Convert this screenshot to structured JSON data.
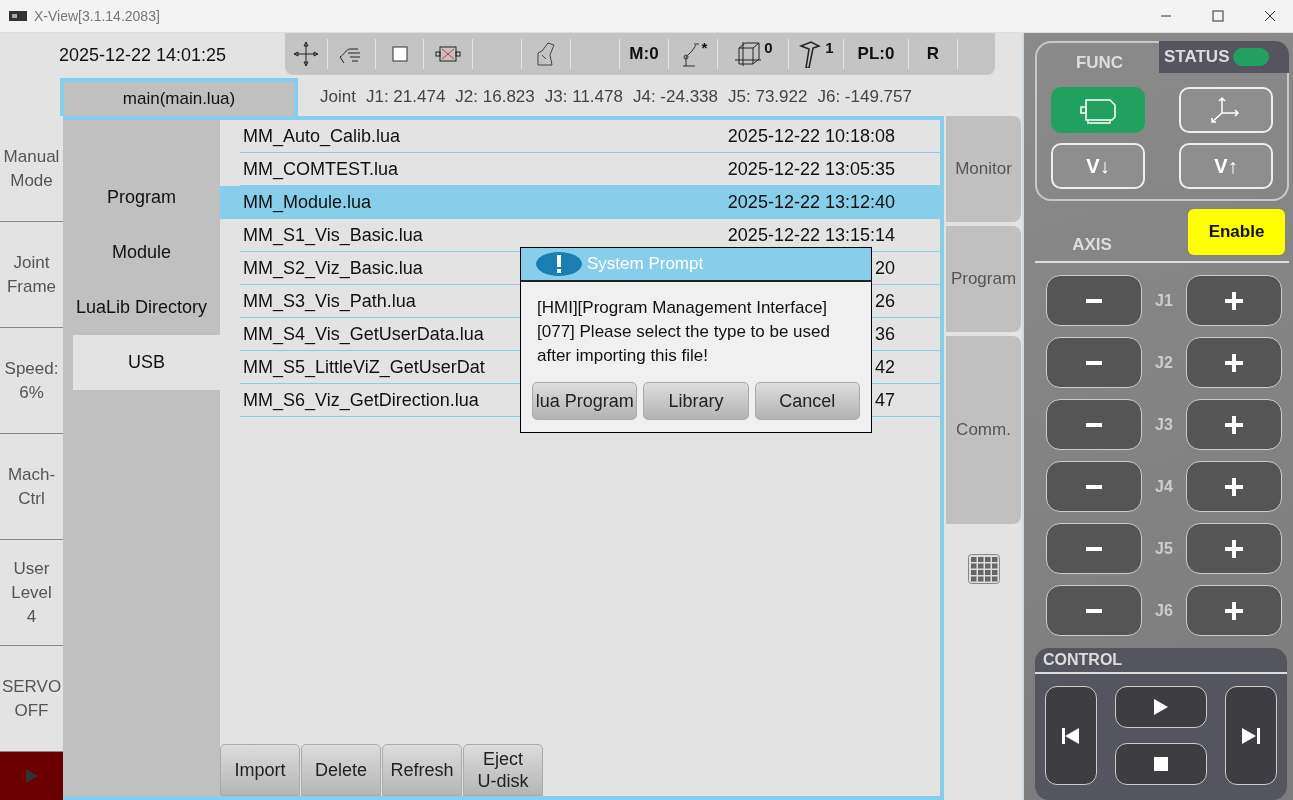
{
  "window": {
    "title": "X-View[3.1.14.2083]"
  },
  "header": {
    "datetime": "2025-12-22 14:01:25",
    "mode_counter": "M:0",
    "robot_mark": "*",
    "frame_count": "0",
    "tool_count": "1",
    "payload": "PL:0",
    "run_mode": "R"
  },
  "tabs": [
    {
      "label": "main(main.lua)",
      "selected": true
    }
  ],
  "coordinates": {
    "frame": "Joint",
    "axes": [
      {
        "label": "J1:",
        "value": "21.474"
      },
      {
        "label": "J2:",
        "value": "16.823"
      },
      {
        "label": "J3:",
        "value": "11.478"
      },
      {
        "label": "J4:",
        "value": "-24.338"
      },
      {
        "label": "J5:",
        "value": "73.922"
      },
      {
        "label": "J6:",
        "value": "-149.757"
      }
    ]
  },
  "mode_nav": [
    {
      "label": "Manual\nMode"
    },
    {
      "label": "Joint\nFrame"
    },
    {
      "label": "Speed:\n6%"
    },
    {
      "label": "Mach-\nCtrl"
    },
    {
      "label": "User\nLevel\n4"
    },
    {
      "label": "SERVO\nOFF"
    }
  ],
  "categories": [
    {
      "label": "Program",
      "selected": false
    },
    {
      "label": "Module",
      "selected": false
    },
    {
      "label": "LuaLib Directory",
      "selected": false
    },
    {
      "label": "USB",
      "selected": true
    }
  ],
  "files": [
    {
      "name": "MM_Auto_Calib.lua",
      "modified": "2025-12-22 10:18:08",
      "selected": false
    },
    {
      "name": "MM_COMTEST.lua",
      "modified": "2025-12-22 13:05:35",
      "selected": false
    },
    {
      "name": "MM_Module.lua",
      "modified": "2025-12-22 13:12:40",
      "selected": true
    },
    {
      "name": "MM_S1_Vis_Basic.lua",
      "modified": "2025-12-22 13:15:14",
      "selected": false
    },
    {
      "name": "MM_S2_Viz_Basic.lua",
      "modified": "20",
      "selected": false
    },
    {
      "name": "MM_S3_Vis_Path.lua",
      "modified": "26",
      "selected": false
    },
    {
      "name": "MM_S4_Vis_GetUserData.lua",
      "modified": "36",
      "selected": false
    },
    {
      "name": "MM_S5_LittleViZ_GetUserDat",
      "modified": "42",
      "selected": false
    },
    {
      "name": "MM_S6_Viz_GetDirection.lua",
      "modified": "47",
      "selected": false
    }
  ],
  "actions": [
    "Import",
    "Delete",
    "Refresh",
    "Eject\nU-disk"
  ],
  "side_tabs": [
    {
      "label": "Monitor"
    },
    {
      "label": "Program"
    },
    {
      "label": "Comm."
    }
  ],
  "dialog": {
    "title": "System Prompt",
    "message": "[HMI][Program Management Interface][077] Please select the type to be used after importing this file!",
    "buttons": [
      "lua Program",
      "Library",
      "Cancel"
    ]
  },
  "func": {
    "title": "FUNC",
    "status_label": "STATUS",
    "status_on": true,
    "buttons": [
      {
        "active": true
      },
      {
        "active": false
      },
      {
        "label": "V↓",
        "active": false
      },
      {
        "label": "V↑",
        "active": false
      }
    ]
  },
  "enable": "Enable",
  "axis": {
    "title": "AXIS",
    "joints": [
      "J1",
      "J2",
      "J3",
      "J4",
      "J5",
      "J6"
    ]
  },
  "control": {
    "title": "CONTROL"
  }
}
